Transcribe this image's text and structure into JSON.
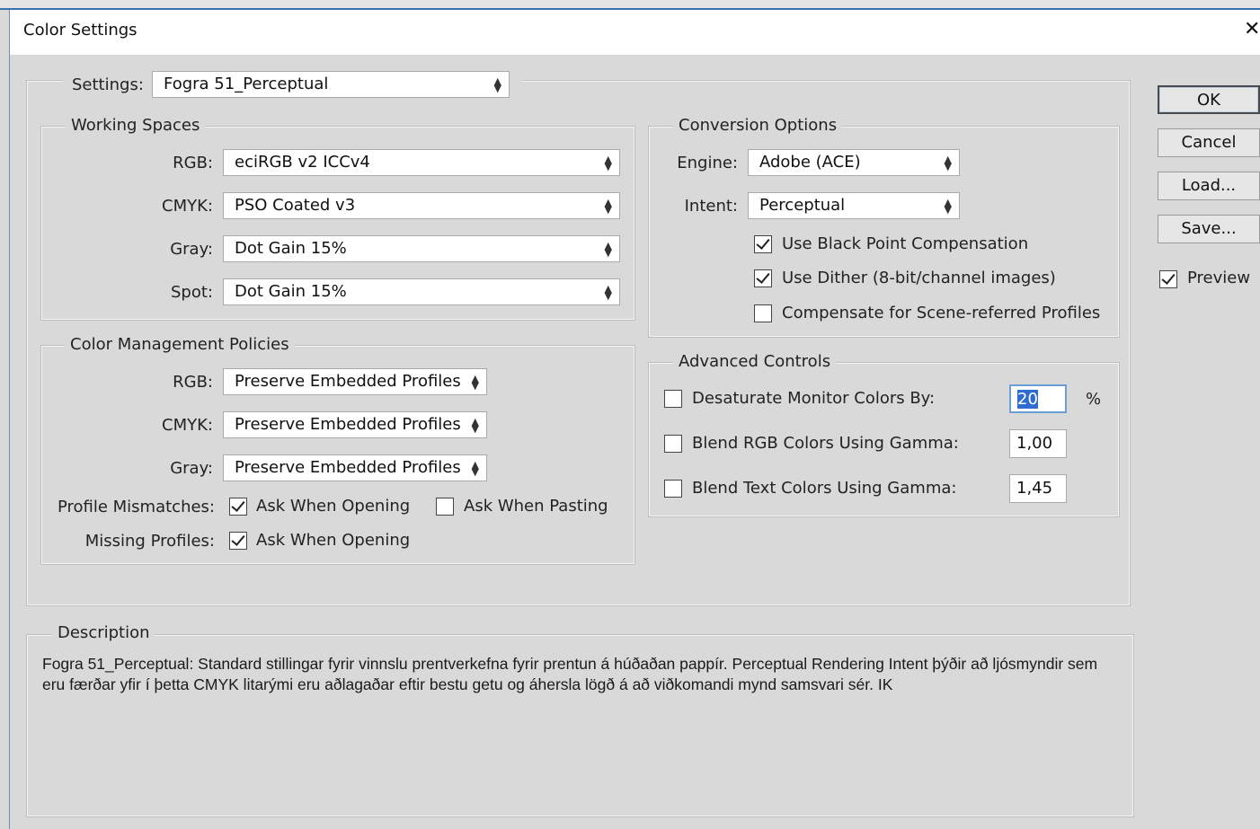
{
  "window": {
    "title": "Color Settings",
    "close_glyph": "✕"
  },
  "settings": {
    "label": "Settings:",
    "value": "Fogra 51_Perceptual"
  },
  "working_spaces": {
    "legend": "Working Spaces",
    "rows": [
      {
        "label": "RGB:",
        "value": "eciRGB v2 ICCv4"
      },
      {
        "label": "CMYK:",
        "value": "PSO Coated v3"
      },
      {
        "label": "Gray:",
        "value": "Dot Gain 15%"
      },
      {
        "label": "Spot:",
        "value": "Dot Gain 15%"
      }
    ]
  },
  "policies": {
    "legend": "Color Management Policies",
    "rows": [
      {
        "label": "RGB:",
        "value": "Preserve Embedded Profiles"
      },
      {
        "label": "CMYK:",
        "value": "Preserve Embedded Profiles"
      },
      {
        "label": "Gray:",
        "value": "Preserve Embedded Profiles"
      }
    ],
    "profile_mismatches": {
      "label": "Profile Mismatches:",
      "ask_opening": {
        "label": "Ask When Opening",
        "checked": true
      },
      "ask_pasting": {
        "label": "Ask When Pasting",
        "checked": false
      }
    },
    "missing_profiles": {
      "label": "Missing Profiles:",
      "ask_opening": {
        "label": "Ask When Opening",
        "checked": true
      }
    }
  },
  "conversion": {
    "legend": "Conversion Options",
    "engine": {
      "label": "Engine:",
      "value": "Adobe (ACE)"
    },
    "intent": {
      "label": "Intent:",
      "value": "Perceptual"
    },
    "black_point": {
      "label": "Use Black Point Compensation",
      "checked": true
    },
    "dither": {
      "label": "Use Dither (8-bit/channel images)",
      "checked": true
    },
    "scene_referred": {
      "label": "Compensate for Scene-referred Profiles",
      "checked": false
    }
  },
  "advanced": {
    "legend": "Advanced Controls",
    "desaturate": {
      "label": "Desaturate Monitor Colors By:",
      "value": "20",
      "unit": "%",
      "checked": false
    },
    "blend_rgb": {
      "label": "Blend RGB Colors Using Gamma:",
      "value": "1,00",
      "checked": false
    },
    "blend_text": {
      "label": "Blend Text Colors Using Gamma:",
      "value": "1,45",
      "checked": false
    }
  },
  "buttons": {
    "ok": "OK",
    "cancel": "Cancel",
    "load": "Load...",
    "save": "Save..."
  },
  "preview": {
    "label": "Preview",
    "checked": true
  },
  "description": {
    "legend": "Description",
    "text": "Fogra 51_Perceptual:  Standard stillingar fyrir vinnslu prentverkefna fyrir prentun á húðaðan pappír. Perceptual Rendering Intent þýðir að ljósmyndir sem eru færðar yfir í þetta CMYK litarými eru aðlagaðar eftir bestu getu og áhersla lögð á að viðkomandi mynd samsvari sér. IK"
  },
  "colors": {
    "selection": "#2f6cd1",
    "focus_border": "#6a9fd8",
    "background": "#d9d9d9"
  }
}
